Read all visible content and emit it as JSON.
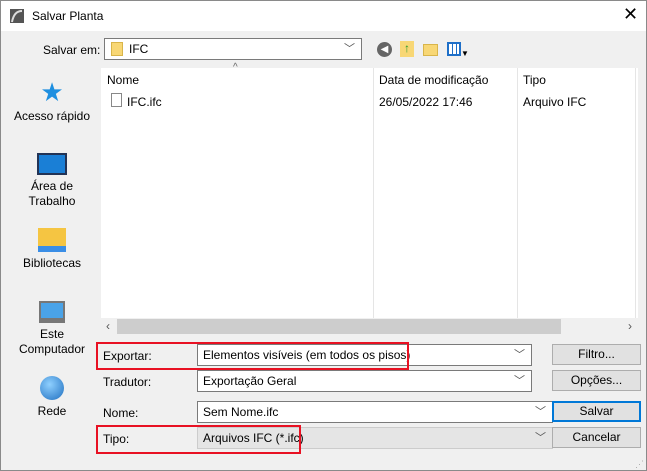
{
  "title": "Salvar Planta",
  "save_in": {
    "label": "Salvar em:",
    "value": "IFC"
  },
  "sidebar": [
    {
      "label": "Acesso rápido",
      "icon": "star-icon"
    },
    {
      "label": "Área de Trabalho",
      "icon": "desktop-icon"
    },
    {
      "label": "Bibliotecas",
      "icon": "library-folder-icon"
    },
    {
      "label": "Este Computador",
      "icon": "computer-icon"
    },
    {
      "label": "Rede",
      "icon": "network-icon"
    }
  ],
  "columns": {
    "name": "Nome",
    "date": "Data de modificação",
    "type": "Tipo"
  },
  "files": [
    {
      "name": "IFC.ifc",
      "date": "26/05/2022 17:46",
      "type": "Arquivo IFC"
    }
  ],
  "form": {
    "export_label": "Exportar:",
    "export_value": "Elementos visíveis (em todos os pisos)",
    "translator_label": "Tradutor:",
    "translator_value": "Exportação Geral",
    "name_label": "Nome:",
    "name_value": "Sem Nome.ifc",
    "type_label": "Tipo:",
    "type_value": "Arquivos IFC (*.ifc)"
  },
  "buttons": {
    "filter": "Filtro...",
    "options": "Opções...",
    "save": "Salvar",
    "cancel": "Cancelar"
  },
  "colors": {
    "accent": "#0078d7",
    "highlight": "#e81123"
  }
}
